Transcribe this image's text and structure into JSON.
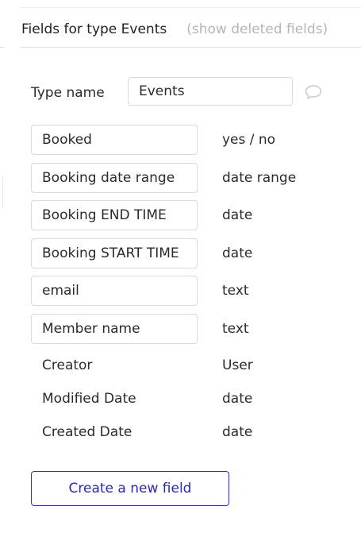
{
  "header": {
    "title": "Fields for type Events",
    "show_deleted_link": "(show deleted fields)"
  },
  "type_name": {
    "label": "Type name",
    "value": "Events"
  },
  "fields": [
    {
      "name": "Booked",
      "type": "yes / no",
      "editable": true
    },
    {
      "name": "Booking date range",
      "type": "date range",
      "editable": true
    },
    {
      "name": "Booking END TIME",
      "type": "date",
      "editable": true
    },
    {
      "name": "Booking START TIME",
      "type": "date",
      "editable": true
    },
    {
      "name": "email",
      "type": "text",
      "editable": true
    },
    {
      "name": "Member name",
      "type": "text",
      "editable": true
    },
    {
      "name": "Creator",
      "type": "User",
      "editable": false
    },
    {
      "name": "Modified Date",
      "type": "date",
      "editable": false
    },
    {
      "name": "Created Date",
      "type": "date",
      "editable": false
    }
  ],
  "create_button": {
    "label": "Create a new field"
  },
  "icons": {
    "comment": "comment-bubble-icon"
  },
  "colors": {
    "accent": "#2f2fc2",
    "muted_link": "#b5b5b5",
    "border": "#d9d9d9"
  }
}
